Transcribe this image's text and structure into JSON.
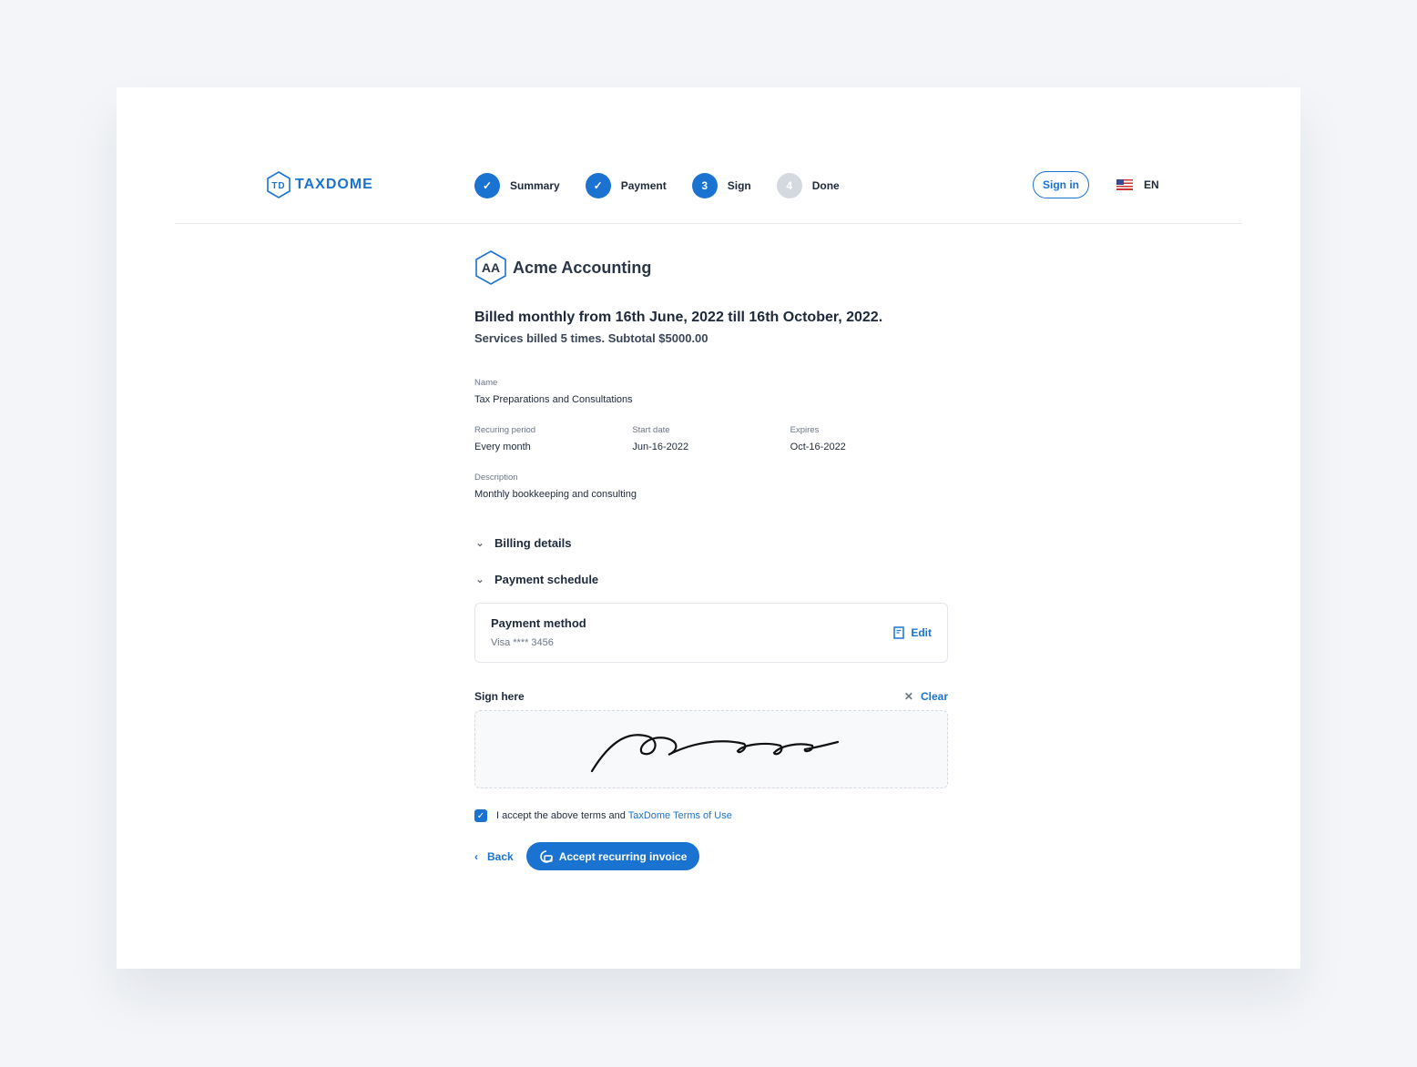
{
  "brand": {
    "logo_mark": "TD",
    "name": "TAXDOME",
    "accent": "#1a73d0"
  },
  "steps": [
    {
      "label": "Summary",
      "state": "done"
    },
    {
      "label": "Payment",
      "state": "done"
    },
    {
      "label": "Sign",
      "number": "3",
      "state": "current"
    },
    {
      "label": "Done",
      "number": "4",
      "state": "pending"
    }
  ],
  "header": {
    "signin": "Sign in",
    "language": "EN"
  },
  "org": {
    "initials": "AA",
    "name": "Acme Accounting"
  },
  "invoice": {
    "title": "Billed monthly from 16th June, 2022 till 16th October, 2022.",
    "subtitle": "Services billed 5 times. Subtotal $5000.00",
    "name_label": "Name",
    "name": "Tax Preparations and Consultations",
    "period_label": "Recuring period",
    "period": "Every month",
    "start_label": "Start date",
    "start": "Jun-16-2022",
    "expires_label": "Expires",
    "expires": "Oct-16-2022",
    "desc_label": "Description",
    "desc": "Monthly bookkeeping and consulting"
  },
  "sections": {
    "billing": "Billing details",
    "schedule": "Payment schedule"
  },
  "payment": {
    "title": "Payment  method",
    "value": "Visa **** 3456",
    "edit": "Edit"
  },
  "sign": {
    "label": "Sign here",
    "clear": "Clear"
  },
  "terms": {
    "text": "I accept the above terms and ",
    "link": "TaxDome Terms of Use",
    "checked": true
  },
  "actions": {
    "back": "Back",
    "accept": "Accept recurring invoice"
  }
}
